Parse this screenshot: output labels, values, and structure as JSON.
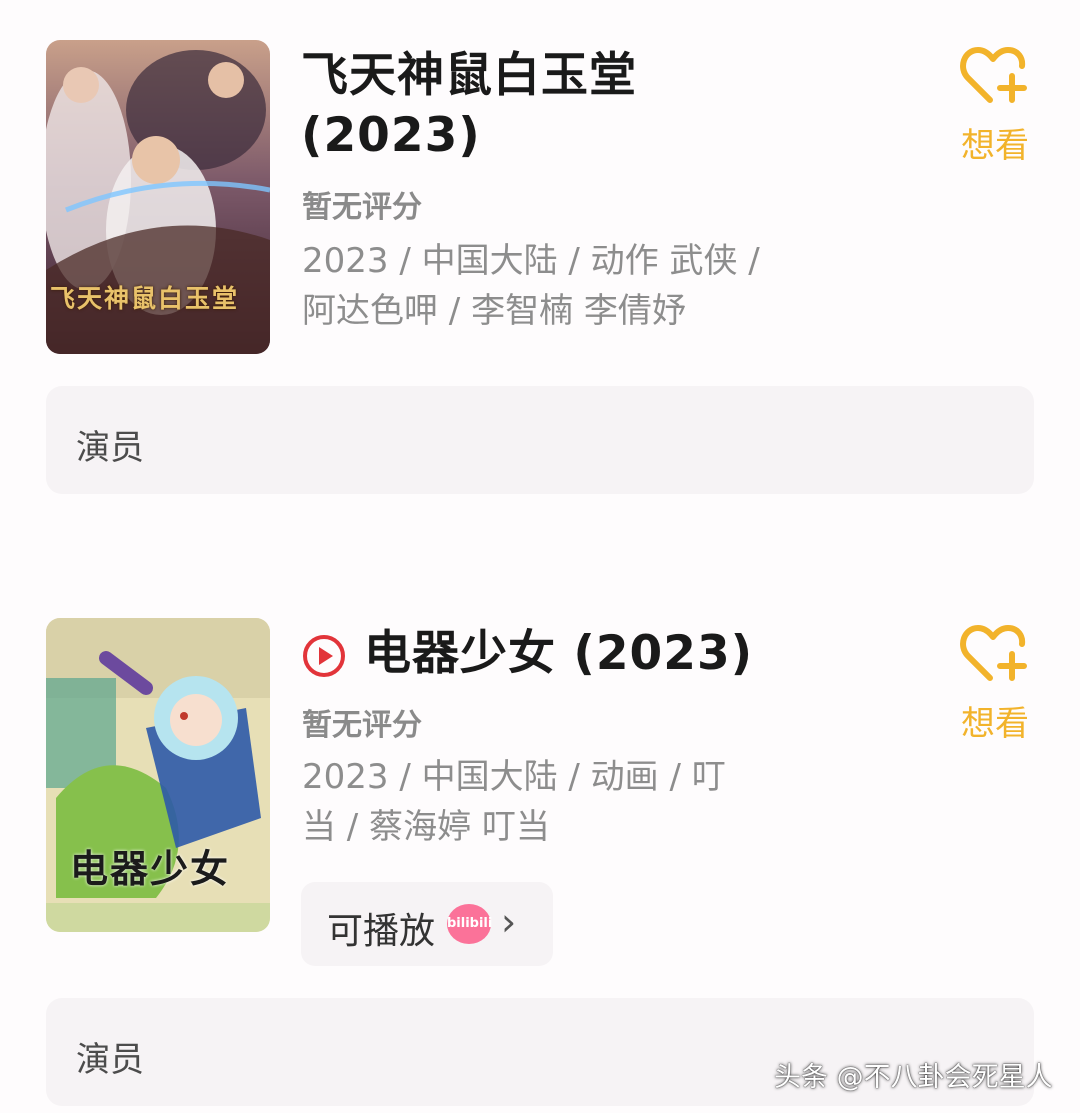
{
  "movies": [
    {
      "title_line1": "飞天神鼠白玉堂",
      "title_line2": "(2023)",
      "rating": "暂无评分",
      "meta_line1": "2023 / 中国大陆 / 动作 武侠 /",
      "meta_line2": "阿达色呷 / 李智楠 李倩妤",
      "want_label": "想看",
      "poster_text": "飞天神鼠白玉堂",
      "actors_label": "演员"
    },
    {
      "title": "电器少女 (2023)",
      "rating": "暂无评分",
      "meta_line1": "2023 / 中国大陆 / 动画 / 叮",
      "meta_line2": "当 / 蔡海婷 叮当",
      "want_label": "想看",
      "poster_text": "电器少女",
      "play_label": "可播放",
      "platform_badge": "bilibili",
      "actors_label": "演员"
    }
  ],
  "watermark": "头条 @不八卦会死星人",
  "colors": {
    "accent": "#f2b32b",
    "play_red": "#e2343a",
    "bili_pink": "#fb7299"
  }
}
